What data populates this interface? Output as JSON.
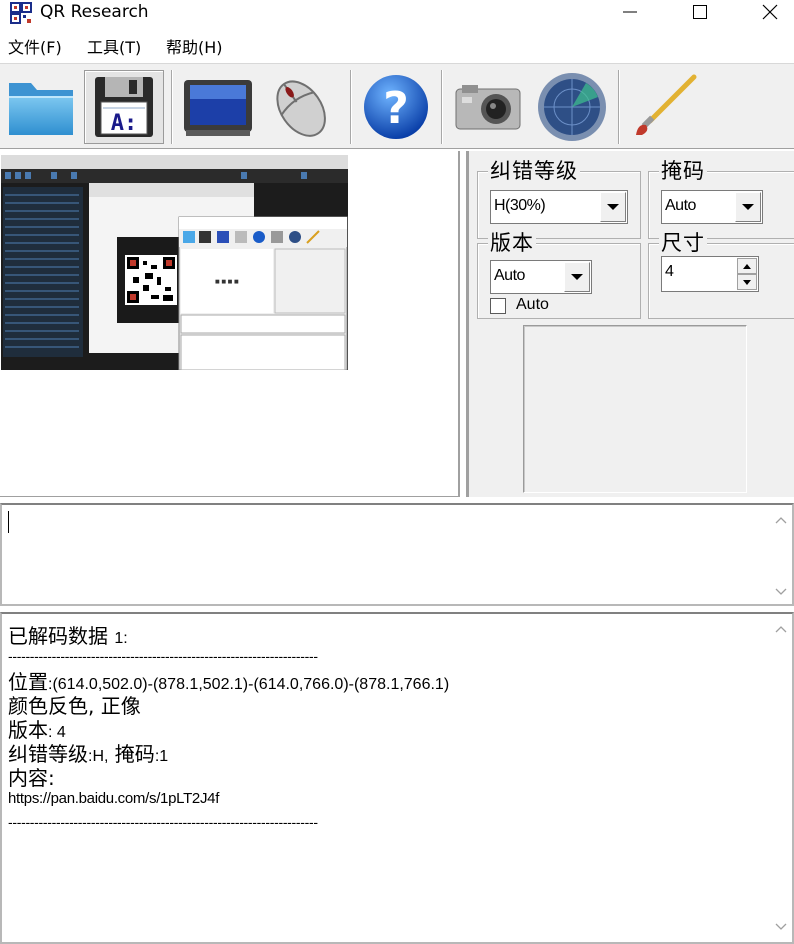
{
  "window": {
    "title": "QR Research"
  },
  "menu": [
    {
      "label": "文件(F)"
    },
    {
      "label": "工具(T)"
    },
    {
      "label": "帮助(H)"
    }
  ],
  "toolbar": {
    "buttons": [
      {
        "icon": "folder-open-icon"
      },
      {
        "icon": "save-disk-icon",
        "pressed": true
      },
      {
        "icon": "monitor-icon"
      },
      {
        "icon": "mouse-icon"
      },
      {
        "icon": "help-icon"
      },
      {
        "icon": "camera-icon"
      },
      {
        "icon": "radar-icon"
      },
      {
        "icon": "brush-icon"
      }
    ]
  },
  "settings": {
    "ecc": {
      "label": "纠错等级",
      "value": "H(30%)"
    },
    "mask": {
      "label": "掩码",
      "value": "Auto"
    },
    "version": {
      "label": "版本",
      "value": "Auto",
      "checkbox_label": "Auto",
      "checked": false
    },
    "size": {
      "label": "尺寸",
      "value": "4"
    }
  },
  "output": {
    "header_label": "已解码数据",
    "header_index": "1:",
    "separator": "-----------------------------------------------------------------------",
    "position_label": "位置",
    "position_value": ":(614.0,502.0)-(878.1,502.1)-(614.0,766.0)-(878.1,766.1)",
    "color_line": "颜色反色, 正像",
    "version_label": "版本",
    "version_value": ": 4",
    "ecc_label": "纠错等级",
    "ecc_value": ":H,",
    "mask_label": " 掩码",
    "mask_value": ":1",
    "content_label": "内容:",
    "content_value": "https://pan.baidu.com/s/1pLT2J4f"
  },
  "colors": {
    "panel_bg": "#f0f0f0",
    "accent_blue": "#1e5fbf"
  }
}
